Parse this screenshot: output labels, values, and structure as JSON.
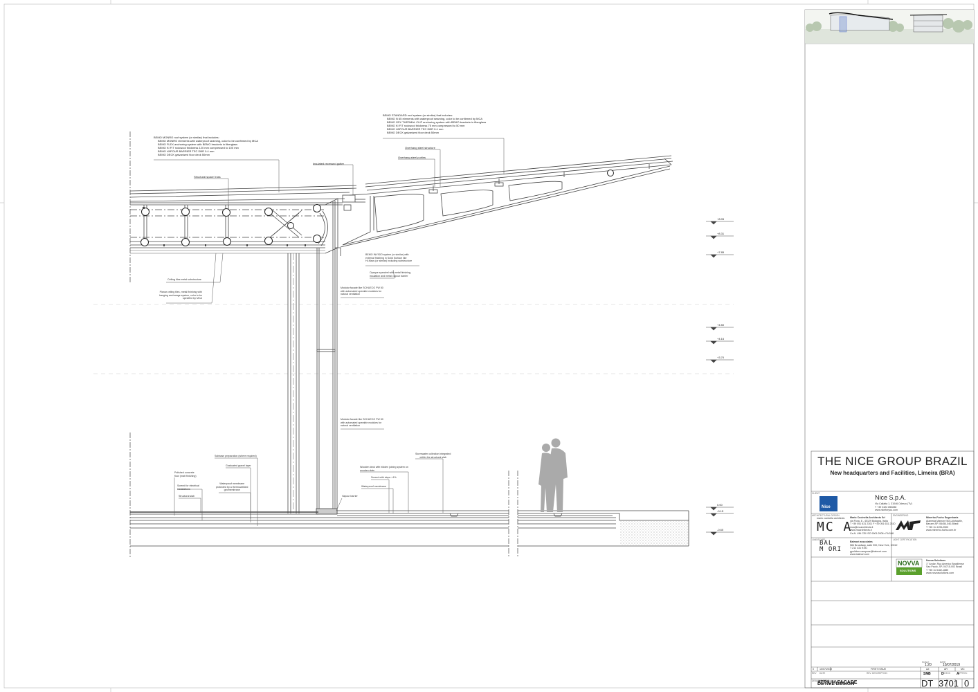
{
  "project": {
    "title": "THE NICE GROUP BRAZIL",
    "subtitle": "New headquarters and Facilities, Limeira (BRA)"
  },
  "client": {
    "name": "Nice S.p.A.",
    "address_lines": [
      "Via Callalta 1, 31046 Oderzo (TV)",
      "T +39 0422 853838",
      "www.niceforyou.com"
    ],
    "logo_text": "Nice"
  },
  "architect": {
    "logo_text": "MC A",
    "logo_caption": "mario cucinella architects",
    "lines": [
      "Mario Cucinella Architects Srl",
      "via Flora, 8 - 40129 Bologna, Italia",
      "T +39 051 631 2301  F +39 051 631 2310",
      "mca@mcarchitects.it",
      "www.mcarchitects.it",
      "Ca.N. UNI CEI ISO 9001:2008 n°04188"
    ]
  },
  "engineer": {
    "lines": [
      "Minerbo-Fuchs Engenharia",
      "Alameda Mamoré 503-Alphaville,",
      "Barueri-SP, 06454-040-Brasil",
      "T +55 11 4195-2500",
      "www.minerbo-fuchs.com.br"
    ]
  },
  "balmori": {
    "logo_lines": [
      "BAL",
      "M ORI"
    ],
    "lines": [
      "Balmori associates",
      "584 Broadway, suite 900, New York, 10012",
      "T 212 431 9191",
      "gpolicker.campuse@balmori.com",
      "www.balmori.com"
    ]
  },
  "novva": {
    "logo_text": "NOVVA",
    "logo_sub": "SOLUTIONS",
    "lines": [
      "Novva Solutions",
      "1° Andar, Rua Americo Brasiliense",
      "Sao Paulo, SP, 04715-002 Brasil",
      "T +55 11 5182-1880",
      "www.novvasolutions.com"
    ]
  },
  "labels": {
    "client": "CLIENT",
    "arch_design": "ARCHITECTURAL DESIGN",
    "engineering": "ENGINEERING",
    "landscape": "LANDSCAPE",
    "lighting": "LIGHT CERTIFICATION",
    "rev": "REV",
    "date": "DATE",
    "rev_desc": "REV. DESCRIPTION",
    "aut": "AUT.",
    "check": "CHECK",
    "approv": "APPROV.",
    "scale": "SCALE",
    "date2": "DATE",
    "drawing_title": "DRAWING TITLE",
    "code": "CODE"
  },
  "revision": {
    "num": "0",
    "date": "10/07/2019",
    "desc": "FIRST ISSUE",
    "aut": "AZ",
    "check": "AR",
    "approv": "MC"
  },
  "sheet": {
    "scale": "1:20",
    "date": "10/07/2019",
    "stage": "DETAIL DESIGN",
    "drawing_title": "ATRIUM FACADE",
    "code1": "SNB",
    "code2": "D",
    "code3": "A",
    "type": "DT",
    "number": "3701",
    "rev": "0"
  },
  "levels": [
    "+8.05",
    "+8.31",
    "+7.85",
    "+4.50",
    "+4.16",
    "+3.70",
    "0.00",
    "-0.15",
    "-0.60"
  ],
  "annotations": {
    "monro": {
      "head": "BEMO MONRO roof system (or similar) that includes:",
      "items": [
        "BEMO MONRO elements with waterproof seaming, color to be confirmed by MCA",
        "BEMO FLEX anchoring system with BEMO brackets in fiberglass",
        "BEMO KI FIT rockwool thickness 120 mm compressed to 100 mm",
        "BEMO VAPOUR BARRIER TEC DBR 0.4 mm",
        "BEMO DECK galvanized floor deck 50mm"
      ]
    },
    "standard": {
      "head": "BEMO STANDARD roof system (or similar) that includes:",
      "items": [
        "BEMO N 65 elements with waterproof seaming, color to be confirmed by MCA",
        "BEMO GFK THERMAL CLIP anchoring system with BEMO brackets in fiberglass",
        "BEMO KI FIT rockwool thickness 75 mm compressed to 50 mm",
        "BEMO VAPOUR BARRIER TEC DBR 0.4 mm",
        "BEMO DECK galvanized floor deck 50mm"
      ]
    },
    "overhang_steel": "Overhang steel structure",
    "overhang_purlins": "Overhang steel purlins",
    "gutter": "Insulated recessed gutter",
    "space_truss": "Structural space truss",
    "ceiling_metal": "Ceiling tiles metal substructure",
    "ceiling_tiles": [
      "Planar ceiling tiles, metal finishing with",
      "hanging anchorage system, color to be",
      "specified by MCA"
    ],
    "invisio": [
      "BEMO INVISIO system (or similar) with",
      "external finishing in Solid Surface like",
      "Hi-Macs (or similar) including substructure"
    ],
    "opaque": [
      "Opaque spandrel with metal finishing,",
      "insulation and metal vapour barrier"
    ],
    "modular_top": [
      "Modular facade like SCHUECO FW 50",
      "with automated operable modules for",
      "natural ventilation"
    ],
    "modular_bottom": [
      "Modular facade like SCHUECO FW 50",
      "with automated operable modules for",
      "natural ventilation"
    ],
    "subbase": "Subbase preparation (where required)",
    "gravel": "Graduated gravel layer",
    "polished": [
      "Polished concrete",
      "floor (matt finishing)"
    ],
    "screed_elec": [
      "Screed for electrical",
      "installations"
    ],
    "membrane": [
      "Waterproof membrane",
      "protected by a thermowelded",
      "geomembrane"
    ],
    "structural_slab": "Structural slab",
    "vapour": "Vapour barrier",
    "wooden": [
      "Wooden deck with hidden joining system on",
      "wooden slats"
    ],
    "screed_slope": "Screed with slope >1%",
    "waterproof": "Waterproof membrane",
    "storm": [
      "Stormwater collection integrated",
      "within the structural slab"
    ]
  }
}
